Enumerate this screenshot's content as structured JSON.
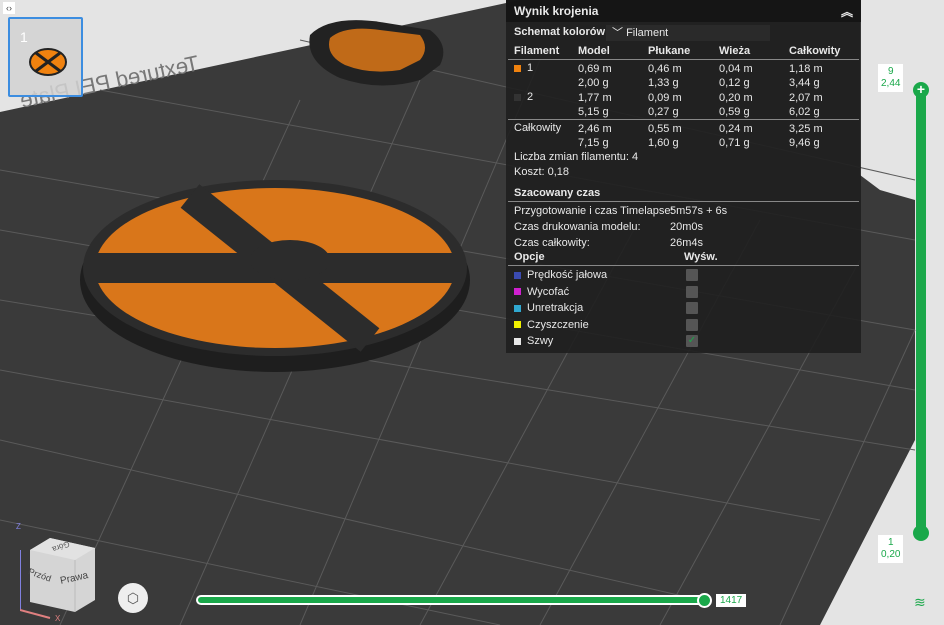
{
  "thumbnail": {
    "index": "1"
  },
  "panel": {
    "title": "Wynik krojenia",
    "scheme_label": "Schemat kolorów",
    "scheme_value": "Filament",
    "headers": [
      "Filament",
      "Model",
      "Płukane",
      "Wieża",
      "Całkowity"
    ],
    "filaments": [
      {
        "id": "1",
        "color": "#f0820f",
        "model": [
          "0,69 m",
          "2,00 g"
        ],
        "flush": [
          "0,46 m",
          "1,33 g"
        ],
        "tower": [
          "0,04 m",
          "0,12 g"
        ],
        "total": [
          "1,18 m",
          "3,44 g"
        ]
      },
      {
        "id": "2",
        "color": "#333333",
        "model": [
          "1,77 m",
          "5,15 g"
        ],
        "flush": [
          "0,09 m",
          "0,27 g"
        ],
        "tower": [
          "0,20 m",
          "0,59 g"
        ],
        "total": [
          "2,07 m",
          "6,02 g"
        ]
      }
    ],
    "totals": {
      "label": "Całkowity",
      "model": [
        "2,46 m",
        "7,15 g"
      ],
      "flush": [
        "0,55 m",
        "1,60 g"
      ],
      "tower": [
        "0,24 m",
        "0,71 g"
      ],
      "total": [
        "3,25 m",
        "9,46 g"
      ]
    },
    "changes": "Liczba zmian filamentu:  4",
    "cost": "Koszt:  0,18",
    "time_title": "Szacowany czas",
    "times": [
      {
        "label": "Przygotowanie i czas Timelapse:",
        "value": "5m57s + 6s"
      },
      {
        "label": "Czas drukowania modelu:",
        "value": "20m0s"
      },
      {
        "label": "Czas całkowity:",
        "value": "26m4s"
      }
    ],
    "options_title": "Opcje",
    "display_title": "Wyśw.",
    "options": [
      {
        "label": "Prędkość jałowa",
        "color": "#3b4bb0",
        "checked": false
      },
      {
        "label": "Wycofać",
        "color": "#d020d0",
        "checked": false
      },
      {
        "label": "Unretrakcja",
        "color": "#30a8d0",
        "checked": false
      },
      {
        "label": "Czyszczenie",
        "color": "#f0f000",
        "checked": false
      },
      {
        "label": "Szwy",
        "color": "#e8e8e8",
        "checked": true
      }
    ]
  },
  "layer_slider": {
    "top_layer": "9",
    "top_height": "2,44",
    "bottom_layer": "1",
    "bottom_height": "0,20"
  },
  "move_slider": {
    "value": "1417"
  },
  "view_cube": {
    "top": "Góra",
    "front": "Przód",
    "right": "Prawa",
    "z": "Z",
    "x": "X"
  }
}
